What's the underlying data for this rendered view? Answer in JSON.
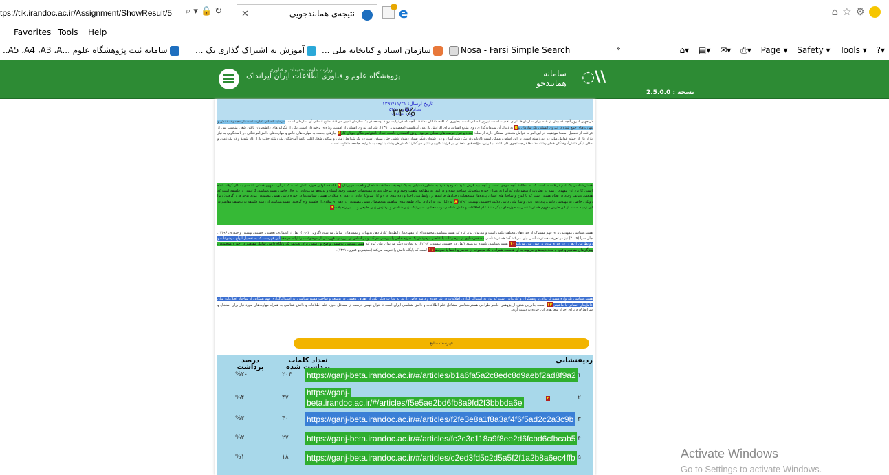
{
  "browser": {
    "url": "tps://tik.irandoc.ac.ir/Assignment/ShowResult/5",
    "url_icons": "⌕ ▾ 🔒 ↻",
    "tab_title": "نتیجه‌ی همانندجویی",
    "menu": [
      "Favorites",
      "Tools",
      "Help"
    ],
    "favorites": [
      "سامانه ثبت پژوهشگاه علوم ...A5 ،A4 ،A3 ،A..",
      "آموزش به اشتراک گذاری یک ...",
      "سازمان اسناد و کتابخانه ملی ...",
      "Nosa - Farsi Simple Search"
    ],
    "cmd_page": "Page ▾",
    "cmd_safety": "Safety ▾",
    "cmd_tools": "Tools ▾"
  },
  "site": {
    "institute": "پژوهشگاه علوم و فناوری اطلاعات ایران  ایرانداک",
    "institute_sub": "وزارت علوم، تحقیقات و فناوری",
    "system_label": "سامانه",
    "system_name": "همانندجو",
    "version": "2.5.0.0 : نسخه"
  },
  "doc": {
    "date_line": "تاریخ ارسال: ۱۳۹۷/۱۱/۲۱",
    "words_line": "تعداد کلمات: ۵۴۶۸",
    "similarity_line": "درصد شباهت:",
    "percent": "۳۴%",
    "p1_a": "در جهان امروز آنچه که بیش از همه برای سازمان‌ها دارای اهمیت است، نیروی انسانی است. بطوری که اقتصاددانان معتقدند آنچه که در نهایت روند توسعه در یک سازمان تعیین می‌کند، منابع انسانی آن سازمان است. ",
    "p1_hl": "سرمایه انسانی عبارت است از مجموعه دانش و مهارت‌های جمع شده در نیروی انسانی یک سازمان و",
    "p1_num1": "۵",
    "p1_b": " به دنبال آن سرمایه‌گذاری روی منابع انسانی برای افزایش بازدهی آن‌هاست (معصومی، ۱۳۹۰). بنابراین نیروی انسانی از اهمیت ویژه‌ای برخوردار است. یکی از نگرانی‌های دانشجویان یافتن شغل مناسب پس از فراغت از تحصیل است؛ موفقیت در این امر به عوامل متعددی بستگی دارد، ازجمله: ",
    "p1_hl2": "تعداد و تنوع فرصت‌های شغلی موجود، رونق اقتصادی جامعه، تعداد دانش‌آموختگان جویای کار",
    "p1_num2": "۶",
    "p1_c": " نیازهای جامعه به مهارت‌های خاص و مهارت‌های دانش‌آموختگان در پاسخگویی به نیاز بازار کار از جمله عوامل مؤثر در این زمینه است. بر این اساس، ممکن است کاریابی در یک رشته آسان و در رشته‌ای دیگر بسیار دشوار باشد. حتی ممکن است در یک شرایط زمانی و مکانی شغل اغلب دانش‌آموختگان یک رشته جذب بازار کار شوند و در یک زمان و مکان دیگر دانش‌آموختگان همان رشته مدت‌ها در جستجوی کار باشند. بنابراین، مؤلفه‌های متعددی بر فرایند کاریابی تأثیر می‌گذارند که در هر رشته با توجه به شرایط جامعه متفاوت است.",
    "p2_hl": "هستی‌شناسی یک علم در فلسفه است که به مطالعهٔ آنچه موجود است و آنچه باید فرض شود که وجود دارد به منظور دستیابی به یک توصیف مطابقت‌کننده از واقعیت می‌پردازد",
    "p2_num1": "۷",
    "p2_a": " فلسفه، اولین حوزه دانش است که در آن، مفهوم هستی شناسی به کار گرفته شده است؛ کاربرد این مفهوم، ریشه در نظریات ارسطو دارد که آنرا به عنوان حوزه متافیزیک شناخته شده و در ابتدا به مطالعه ماهیت وجود و در مرحله بعد به مشخصات حقیقت وجود اشیاء و پدیده‌ها می‌پردازد. در حال حاضر، هستی‌شناسی گرایشی از فلسفه است که هدفش تعریف وجود در نظام هستی است که با انواع و ساختارهای اشیاء، پدیده‌ها، مشخصات رخدادها، فرایند‌ها و روابط میان اجزا و رده بندی جزء و کل سروکار دارد. از دهه ۹۰ میلادی، هستی شناسی‌ها در حوزهٔ دانش هوش مصنوعی مورد توجه قرار گرفت؛ زیرا رویکرد خاصی به مهندسی دانش، پردازش زبان و سازمانی دانش دلالت (حسینی بهشتی، ۱۳۹۲)",
    "p2_num2": "۸",
    "p2_b": " به دلیل نیاز به ابزاری برای طبقه بندی مفاهیم، متخصصان هوش مصنوعی در دهه ۹۰ میلادی از فلسفه وام گرفتند. هستی‌شناسی از رشتهٔ فلسفه به توصیف مفاهیم در این زمینه است. از این طریق مفهوم هستی‌شناسی به حوزه‌های دیگر مانند علم اطلاعات و دانش شناسی، وب معنایی، سیبرنتیک، زبان‌شناسی و پردازش زبان طبیعی و ... نیز راه یافت",
    "p2_num3": "۹",
    "p3_a": "هستی‌شناسی مفهومی برای فهم مشترک از حوزه‌های مختلف علمی است و می‌توان بیان کرد که هستی‌شناسی مجموعه‌ای از مفهوم‌ها، رابطه‌ها، کارکردها، بدیهیات و نمونه‌ها را شامل می‌شود (گروبر، ۱۹۹۳). نقل از اعتمادی، تعصبی، حسینی بهشتی و حیدری، ۱۳۹۶). جان سوا (۲۰۰۹) نیز در تعریف هستی‌شناسی بیان می‌کند که: هستی‌شناسی ",
    "p3_hl": "مشخص‌سازی از موضوعات یا عناصر موجود در یک حوزه خاص را بررسی می‌کند و بر اساس آن بررسی، فهرستی از موضوعات را ارائه می‌دهد",
    "p3_b": " این فهرست که به تفصیل انواع موضوعات و روابط بین آن‌ها را در حوزه مورد بررسی بیان می‌کند",
    "p3_num1": "۱۰",
    "p3_c": " هستی‌شناسی نامیده می‌شود (نقل در حسینی بهشتی، ۱۳۹۷). به عبارت دیگر می‌توان بیان کرد که ",
    "p3_hl2": "هستی‌شناسی توصیفی واضح و رسمی برای تعریف یک پایگاه دانش شامل مفاهیم در حوزه موضوعی، ویژگی‌های مفاهیم و قیود و محدودیت‌های مربوط به آن هاست، همراه با یک مجموعه از عناصر و اعضا یا نمونه‌ها",
    "p3_num2": "۱۱",
    "p3_d": " است که پایگاه دانش را تعریف می‌کند (صدیقی و قنبری، ۱۳۹۱).",
    "p4_hl": "هستی‌شناسی یک واژه مشترک برای پژوهشگران و کاربرانی است که نیاز به اشتراک گذاری اطلاعات در یک حوزه و دامنه خاص دارند. به عبارت دیگر یکی از اهداف معمول در توسعه و ساخت هستی‌شناسی، به اشتراک‌گذاری فهم همگانی از ساختار اطلاعات میان عامل‌های انسانی یا ماشینی",
    "p4_num": "۱۲",
    "p4_a": " است. بنابراین هدف از پژوهش حاضر طراحی هستی‌شناسی مشاغل علم اطلاعات و دانش شناسی ایران است تا بتوان فهمی درست از مشاغل حوزه علم اطلاعات و دانش شناسی به همراه مهارت‌های مورد نیاز برای اشتغال و شرایط لازم برای احراز شغل‌های این حوزه به دست آورد.",
    "sources_button": "فهرست منابع"
  },
  "table": {
    "col_row": "ردیف",
    "col_id": "نشانی",
    "col_words": "تعداد کلمات برداشت شده",
    "col_pct": "درصد برداشت",
    "rows": [
      {
        "n": "۱",
        "url": "https://ganj-beta.irandoc.ac.ir/#/articles/b1a6fa5a2c8edc8d9aebf2ad8f9a2",
        "words": "۲۰۴",
        "pct": "%۲۰",
        "num": "",
        "style": "lg"
      },
      {
        "n": "۲",
        "url": "https://ganj-",
        "url2": "beta.irandoc.ac.ir/#/articles/f5e5ae2bd6fb8a9fd2f3bbbda6e",
        "words": "۴۷",
        "pct": "%۴",
        "num": "۲",
        "style": "lg"
      },
      {
        "n": "۳",
        "url": "https://ganj-beta.irandoc.ac.ir/#/articles/f2fe3e8a1f8a3af4f6f5ad2c2a3c9b",
        "words": "۴۰",
        "pct": "%۳",
        "num": "۳",
        "style": "lb"
      },
      {
        "n": "۴",
        "url": "https://ganj-beta.irandoc.ac.ir/#/articles/fc2c3c118a9f8ee2d6fcbd6cfbcab5",
        "words": "۲۷",
        "pct": "%۲",
        "num": "",
        "style": "lg"
      },
      {
        "n": "۵",
        "url": "https://ganj-beta.irandoc.ac.ir/#/articles/c2ed3fd5c2d5a5f2f1a2b8a6ec4ffb",
        "words": "۱۸",
        "pct": "%۱",
        "num": "",
        "style": "lg"
      }
    ]
  },
  "watermark": {
    "line1": "Activate Windows",
    "line2": "Go to Settings to activate Windows."
  },
  "colors": {
    "banner": "#2d8b34",
    "highlight_green": "#36b936",
    "highlight_blue": "#3b6fd1",
    "table_bg": "#a8d8ea",
    "sources_button": "#f2b400"
  }
}
